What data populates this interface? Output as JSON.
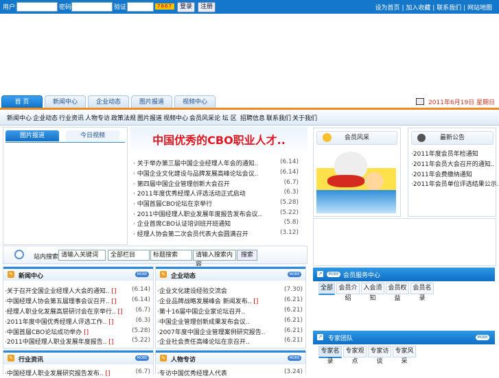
{
  "topbar": {
    "user_label": "用户：",
    "pass_label": "密码：",
    "code_label": "验证：",
    "captcha": "7867",
    "login_button": "登录",
    "register_button": "注册",
    "links": [
      "设为首页",
      "加入收藏",
      "联系我们",
      "网站地图"
    ],
    "separator": "|"
  },
  "nav_tabs": [
    "首 页",
    "新闻中心",
    "企业动态",
    "图片报道",
    "视频中心"
  ],
  "date_text": "2011年6月19日 星期日",
  "secondary_nav": [
    "新闻中心",
    "企业动态",
    "行业资讯",
    "人物专访",
    "政策法规",
    "图片报道",
    "视频中心",
    "会员风采",
    "论 坛 区",
    "招聘信息",
    "联系我们",
    "关于我们"
  ],
  "picture_box": {
    "tab_active": "图片报道",
    "tab_inactive": "今日视频"
  },
  "headline": {
    "title": "中国优秀的CBO职业人才..",
    "items": [
      {
        "title": "关于举办第三届中国企业经理人年会的通知..",
        "date": "(6.14)"
      },
      {
        "title": "中国企业文化建设与品牌发展高峰论坛会议..",
        "date": "(6.14)"
      },
      {
        "title": "第四届中国企业管理创新大会召开",
        "date": "(6.7)"
      },
      {
        "title": "2011年度优秀经理人评选活动正式启动",
        "date": "(6.3)"
      },
      {
        "title": "中国首届CBO论坛在京举行",
        "date": "(5.28)"
      },
      {
        "title": "2011中国经理人职业发展年度报告发布会议..",
        "date": "(5.22)"
      },
      {
        "title": "企业首席CBO认证培训班开班通知",
        "date": "(5.8)"
      },
      {
        "title": "经理人协会第二次会员代表大会圆满召开",
        "date": "(3.12)"
      }
    ]
  },
  "search": {
    "label": "站内搜索：",
    "keyword_value": "请输入关键词",
    "select1": "全部栏目",
    "select2": "标题搜索",
    "input_value": "请输入搜索内容",
    "button": "搜索"
  },
  "sections": [
    {
      "title": "新闻中心",
      "more": "MORE",
      "rows": [
        {
          "title": "关于召开全国企业经理人大会的通知..",
          "mark": "[]",
          "date": "(6.14)"
        },
        {
          "title": "中国经理人协会第五届理事会议召开..",
          "mark": "[]",
          "date": "(6.14)"
        },
        {
          "title": "经理人职业化发展高层研讨会在京举行..",
          "mark": "[]",
          "date": "(6.7)"
        },
        {
          "title": "2011年度中国优秀经理人评选工作..",
          "mark": "[]",
          "date": "(6.3)"
        },
        {
          "title": "中国首届CBO论坛成功举办",
          "mark": "[]",
          "date": "(5.28)"
        },
        {
          "title": "2011中国经理人职业发展年度报告..",
          "mark": "[]",
          "date": "(5.22)"
        }
      ]
    },
    {
      "title": "企业动态",
      "more": "MORE",
      "rows": [
        {
          "title": "企业文化建设经验交流会",
          "mark": "",
          "date": "(7.30)"
        },
        {
          "title": "企业品牌战略发展峰会 新闻发布..",
          "mark": "[]",
          "date": "(6.21)"
        },
        {
          "title": "第十16届中国企业家论坛召开..",
          "mark": "",
          "date": "(6.21)"
        },
        {
          "title": "中国企业管理创新成果发布会议..",
          "mark": "",
          "date": "(6.21)"
        },
        {
          "title": "2007年度中国企业管理案例研究报告..",
          "mark": "",
          "date": "(6.21)"
        },
        {
          "title": "企业社会责任高峰论坛在京召开..",
          "mark": "",
          "date": "(6.21)"
        }
      ]
    },
    {
      "title": "行业资讯",
      "more": "MORE",
      "rows": [
        {
          "title": "中国经理人职业发展研究报告发布..",
          "mark": "[]",
          "date": "(6.7)"
        }
      ]
    },
    {
      "title": "人物专访",
      "more": "MORE",
      "rows": [
        {
          "title": "专访中国优秀经理人代表",
          "mark": "",
          "date": "(3.24)"
        }
      ]
    }
  ],
  "right_boxes": {
    "box1_title": "会员风采",
    "box2_title": "最新公告",
    "box2_items": [
      "2011年度会员年检通知",
      "2011年会员大会召开的通知..",
      "2011年会费缴纳通知",
      "2011年会员单位评选结果公示.."
    ]
  },
  "right_sections": [
    {
      "title": "会员服务中心",
      "more": "MORE",
      "tabs": [
        "全部",
        "会员介绍",
        "入会须知",
        "会员权益",
        "会员名录"
      ]
    },
    {
      "title": "专家团队",
      "more": "MORE",
      "tabs": [
        "专家名录",
        "专家观点",
        "专家访谈",
        "专家风采"
      ]
    }
  ]
}
